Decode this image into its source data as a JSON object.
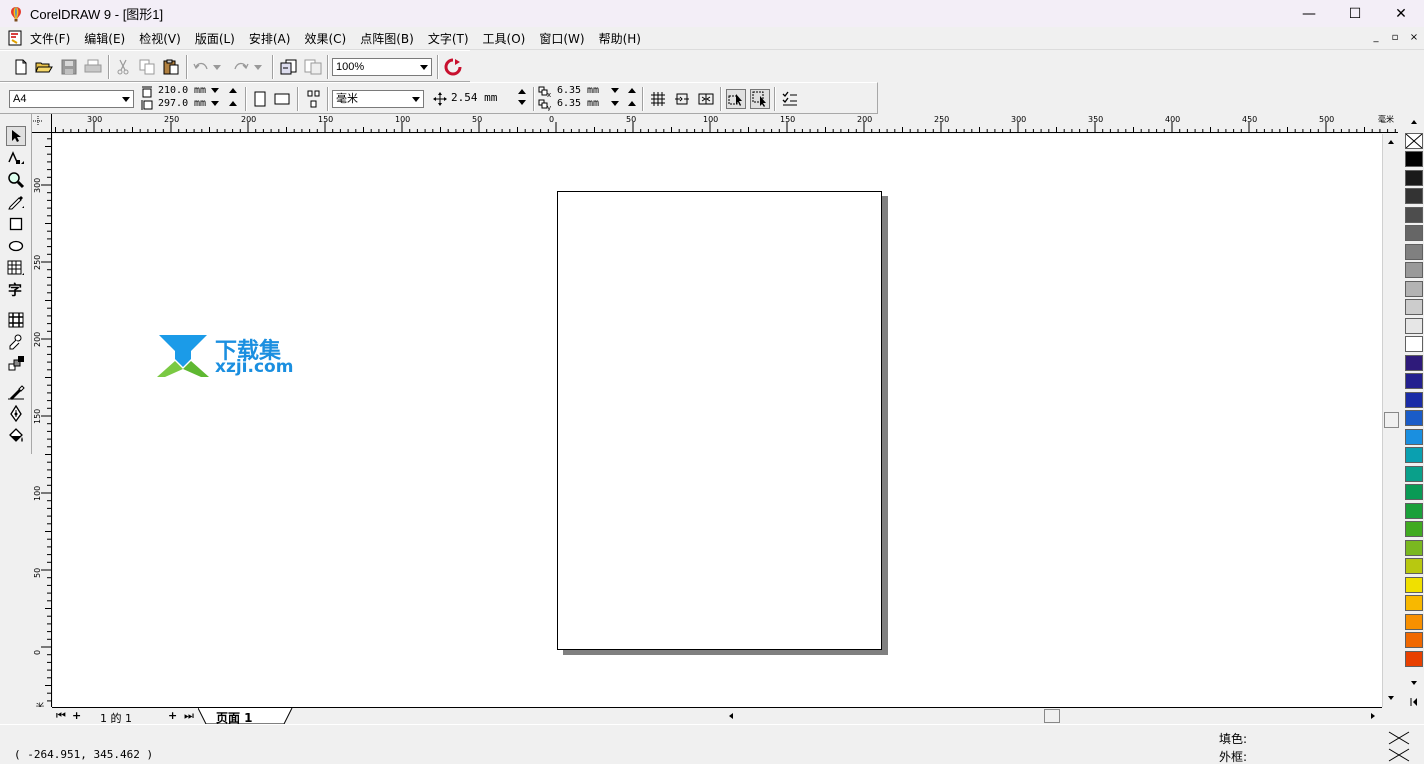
{
  "window": {
    "title": "CorelDRAW 9 - [图形1]",
    "minimize_glyph": "—",
    "maximize_glyph": "☐",
    "close_glyph": "✕"
  },
  "menu": {
    "items": [
      {
        "label": "文件(F)"
      },
      {
        "label": "编辑(E)"
      },
      {
        "label": "检视(V)"
      },
      {
        "label": "版面(L)"
      },
      {
        "label": "安排(A)"
      },
      {
        "label": "效果(C)"
      },
      {
        "label": "点阵图(B)"
      },
      {
        "label": "文字(T)"
      },
      {
        "label": "工具(O)"
      },
      {
        "label": "窗口(W)"
      },
      {
        "label": "帮助(H)"
      }
    ],
    "mdi_min": "_",
    "mdi_restore": "▫",
    "mdi_close": "×"
  },
  "toolbar": {
    "zoom_value": "100%"
  },
  "property_bar": {
    "paper_size": "A4",
    "width": "210.0",
    "height": "297.0",
    "size_unit": "mm",
    "units": "毫米",
    "nudge": "2.54 mm",
    "dup_x": "6.35",
    "dup_y": "6.35",
    "dup_unit": "mm"
  },
  "rulers": {
    "horizontal_labels": [
      "300",
      "250",
      "200",
      "150",
      "100",
      "50",
      "0",
      "50",
      "100",
      "150",
      "200",
      "250",
      "300",
      "350",
      "400",
      "450",
      "500"
    ],
    "horizontal_unit": "毫米",
    "vertical_labels": [
      "300",
      "250",
      "200",
      "150",
      "100",
      "50",
      "0"
    ],
    "vertical_unit": "毫米"
  },
  "watermark": {
    "line1": "下载集",
    "line2": "xzji.com"
  },
  "page_nav": {
    "counter": "1 的 1",
    "tab_label": "页面  1"
  },
  "status": {
    "coordinates": "( -264.951, 345.462 )",
    "fill_label": "填色:",
    "outline_label": "外框:"
  },
  "palette_colors": [
    "#000000",
    "#1a1a1a",
    "#333333",
    "#4d4d4d",
    "#666666",
    "#808080",
    "#999999",
    "#b3b3b3",
    "#cccccc",
    "#e6e6e6",
    "#ffffff",
    "#2e1a7a",
    "#23208f",
    "#1a2ca6",
    "#1a5cc8",
    "#1a8fe0",
    "#0aa0b0",
    "#0aa08a",
    "#0a9a55",
    "#1aa03a",
    "#40aa20",
    "#7ab820",
    "#b8c810",
    "#f0e000",
    "#f8b800",
    "#f89000",
    "#f06800",
    "#e84000"
  ]
}
